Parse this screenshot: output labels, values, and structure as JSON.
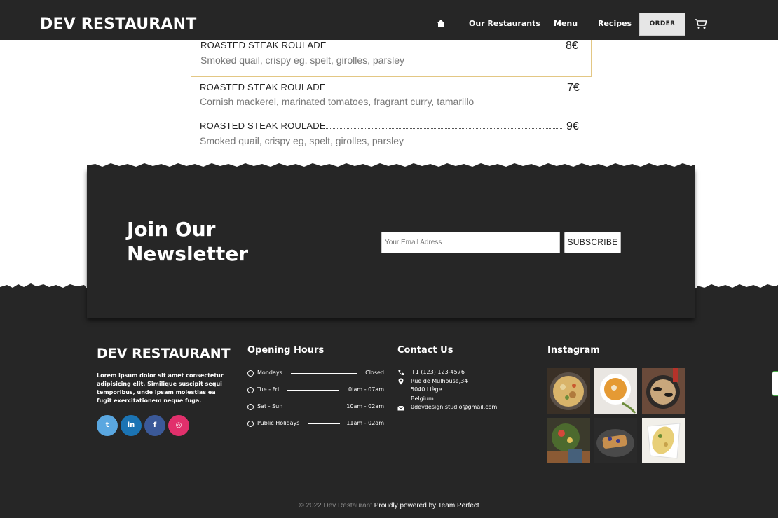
{
  "nav": {
    "brand": "DEV RESTAURANT",
    "links": [
      "Our Restaurants",
      "Menu",
      "Recipes"
    ],
    "order_label": "ORDER"
  },
  "menu_items": [
    {
      "name": "ROASTED STEAK ROULADE",
      "price": "8€",
      "description": "Smoked quail, crispy eg, spelt, girolles, parsley"
    },
    {
      "name": "ROASTED STEAK ROULADE",
      "price": "7€",
      "description": "Cornish mackerel, marinated tomatoes, fragrant curry, tamarillo"
    },
    {
      "name": "ROASTED STEAK ROULADE",
      "price": "9€",
      "description": "Smoked quail, crispy eg, spelt, girolles, parsley"
    }
  ],
  "newsletter": {
    "title": "Join Our Newsletter",
    "email_placeholder": "Your Email Adress",
    "subscribe_label": "SUBSCRIBE"
  },
  "footer": {
    "brand": "DEV RESTAURANT",
    "about": "Lorem ipsum dolor sit amet consectetur adipisicing elit. Similique suscipit sequi temporibus, unde ipsam molestias ea fugit exercitationem neque fuga.",
    "social": [
      {
        "name": "twitter",
        "glyph": "t",
        "color": "#5aa7e0"
      },
      {
        "name": "linkedin",
        "glyph": "in",
        "color": "#1b74b4"
      },
      {
        "name": "facebook",
        "glyph": "f",
        "color": "#3b5998"
      },
      {
        "name": "instagram",
        "glyph": "◎",
        "color": "#e1306c"
      }
    ],
    "opening_hours": {
      "title": "Opening Hours",
      "rows": [
        {
          "day": "Mondays",
          "time": "Closed"
        },
        {
          "day": "Tue - Fri",
          "time": "0Iam - 07am"
        },
        {
          "day": "Sat - Sun",
          "time": "10am - 02am"
        },
        {
          "day": "Public Holidays",
          "time": "11am - 02am"
        }
      ]
    },
    "contact": {
      "title": "Contact Us",
      "phone": "+1 (123) 123-4576",
      "address_line1": "Rue de Mulhouse,34",
      "address_line2": "5040 Liège",
      "address_line3": "Belgium",
      "email": "0devdesign.studio@gmail.com"
    },
    "instagram": {
      "title": "Instagram"
    },
    "copyright": "© 2022 Dev Restaurant",
    "powered": "Proudly powered by Team Perfect"
  }
}
